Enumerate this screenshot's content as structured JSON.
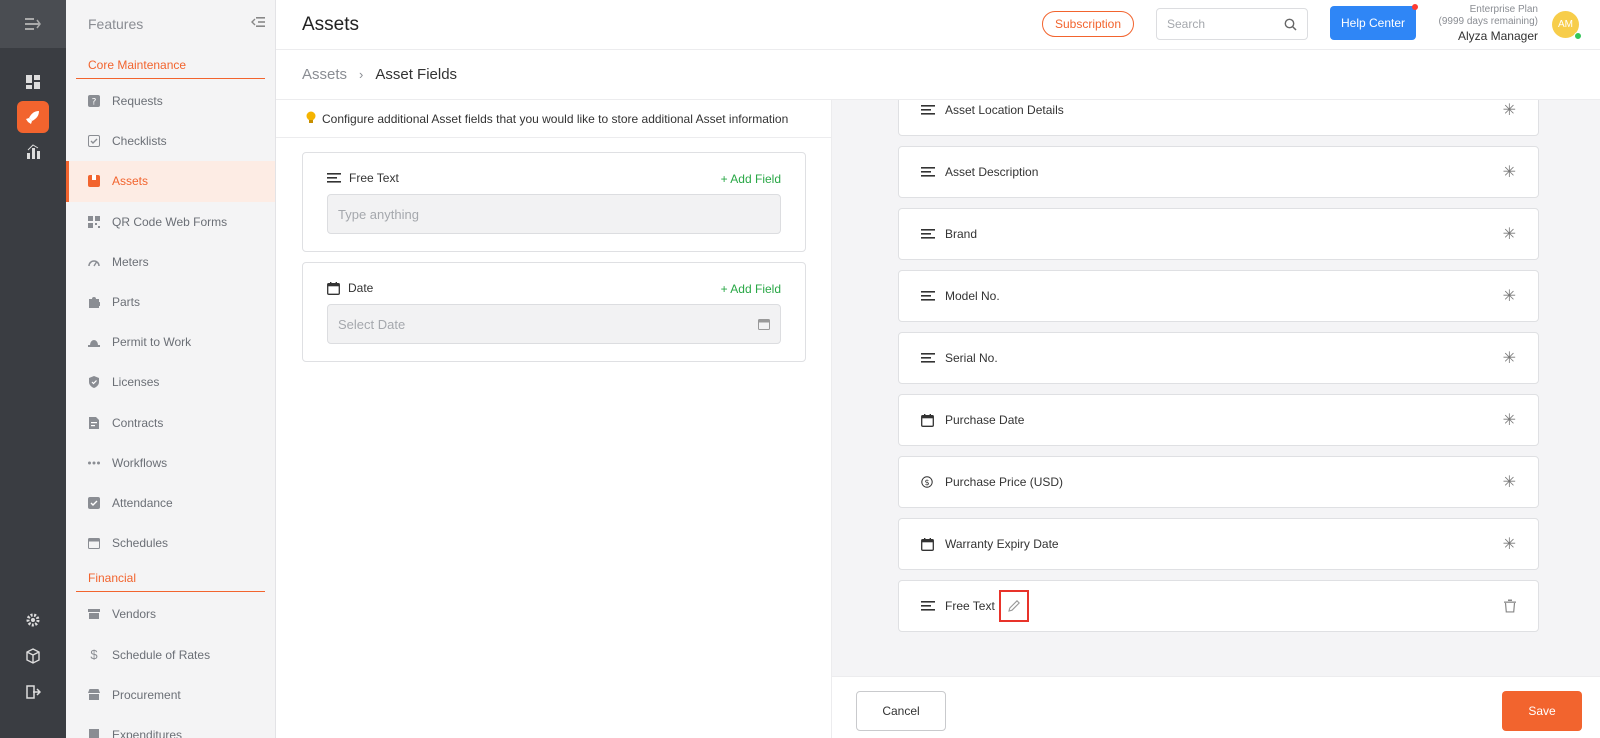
{
  "sidebar": {
    "title": "Features",
    "sections": {
      "core": "Core Maintenance",
      "financial": "Financial"
    },
    "core_items": [
      {
        "label": "Requests"
      },
      {
        "label": "Checklists"
      },
      {
        "label": "Assets"
      },
      {
        "label": "QR Code Web Forms"
      },
      {
        "label": "Meters"
      },
      {
        "label": "Parts"
      },
      {
        "label": "Permit to Work"
      },
      {
        "label": "Licenses"
      },
      {
        "label": "Contracts"
      },
      {
        "label": "Workflows"
      },
      {
        "label": "Attendance"
      },
      {
        "label": "Schedules"
      }
    ],
    "financial_items": [
      {
        "label": "Vendors"
      },
      {
        "label": "Schedule of Rates"
      },
      {
        "label": "Procurement"
      },
      {
        "label": "Expenditures"
      }
    ]
  },
  "header": {
    "title": "Assets",
    "subscription": "Subscription",
    "search_placeholder": "Search",
    "help": "Help Center",
    "plan": "Enterprise Plan",
    "plan_days": "(9999 days remaining)",
    "user": "Alyza Manager",
    "avatar": "AM"
  },
  "breadcrumb": {
    "parent": "Assets",
    "current": "Asset Fields"
  },
  "left": {
    "hint": "Configure additional Asset fields that you would like to store additional Asset information",
    "types": [
      {
        "label": "Free Text",
        "add": "+ Add Field",
        "placeholder": "Type anything"
      },
      {
        "label": "Date",
        "add": "+ Add Field",
        "placeholder": "Select Date"
      }
    ]
  },
  "fields": [
    {
      "label": "Asset Location Details",
      "icon": "text-lines-icon"
    },
    {
      "label": "Asset Description",
      "icon": "text-lines-icon"
    },
    {
      "label": "Brand",
      "icon": "text-lines-icon"
    },
    {
      "label": "Model No.",
      "icon": "text-lines-icon"
    },
    {
      "label": "Serial No.",
      "icon": "text-lines-icon"
    },
    {
      "label": "Purchase Date",
      "icon": "calendar-icon"
    },
    {
      "label": "Purchase Price (USD)",
      "icon": "dollar-icon"
    },
    {
      "label": "Warranty Expiry Date",
      "icon": "calendar-icon"
    },
    {
      "label": "Free Text",
      "icon": "text-lines-icon"
    }
  ],
  "required_mark": "✳",
  "footer": {
    "cancel": "Cancel",
    "save": "Save"
  },
  "colors": {
    "accent": "#f2642e",
    "help": "#2f86f6",
    "add": "#28a745"
  }
}
